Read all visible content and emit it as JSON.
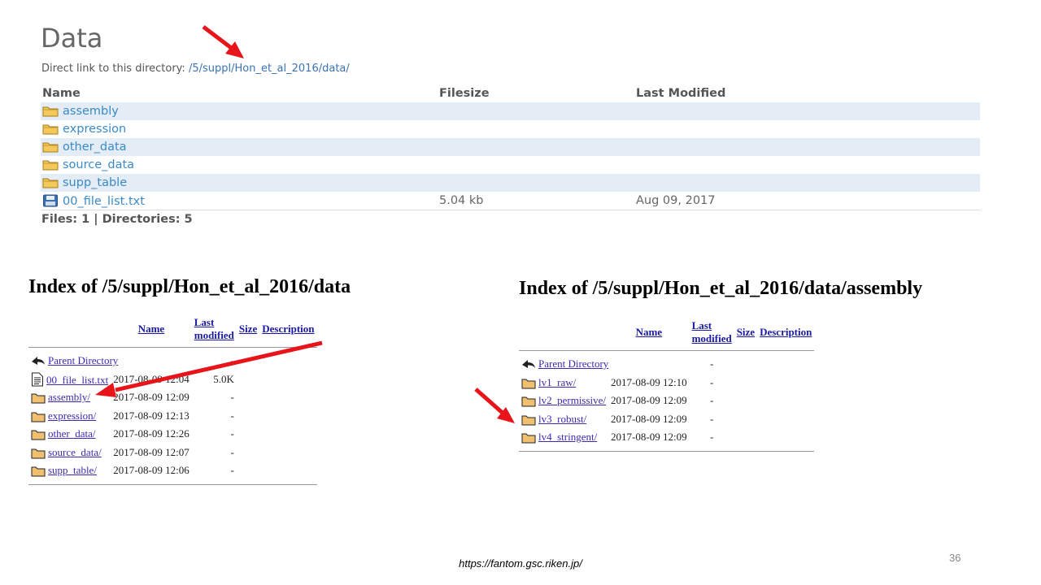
{
  "top": {
    "title": "Data",
    "direct_link_label": "Direct link to this directory:",
    "direct_link": "/5/suppl/Hon_et_al_2016/data/",
    "headers": {
      "name": "Name",
      "filesize": "Filesize",
      "modified": "Last Modified"
    },
    "rows": [
      {
        "name": "assembly",
        "size": "",
        "modified": "",
        "icon": "folder-icon"
      },
      {
        "name": "expression",
        "size": "",
        "modified": "",
        "icon": "folder-icon"
      },
      {
        "name": "other_data",
        "size": "",
        "modified": "",
        "icon": "folder-icon"
      },
      {
        "name": "source_data",
        "size": "",
        "modified": "",
        "icon": "folder-icon"
      },
      {
        "name": "supp_table",
        "size": "",
        "modified": "",
        "icon": "folder-icon"
      },
      {
        "name": "00_file_list.txt",
        "size": "5.04 kb",
        "modified": "Aug 09, 2017",
        "icon": "save-disk-icon"
      }
    ],
    "summary": "Files: 1 | Directories: 5"
  },
  "index_left": {
    "title": "Index of /5/suppl/Hon_et_al_2016/data",
    "headers": {
      "name": "Name",
      "modified": "Last modified",
      "size": "Size",
      "description": "Description"
    },
    "rows": [
      {
        "name": "Parent Directory",
        "modified": "",
        "size": "-",
        "icon": "back-arrow-icon"
      },
      {
        "name": "00_file_list.txt",
        "modified": "2017-08-09 12:04",
        "size": "5.0K",
        "icon": "text-file-icon"
      },
      {
        "name": "assembly/",
        "modified": "2017-08-09 12:09",
        "size": "-",
        "icon": "folder-icon"
      },
      {
        "name": "expression/",
        "modified": "2017-08-09 12:13",
        "size": "-",
        "icon": "folder-icon"
      },
      {
        "name": "other_data/",
        "modified": "2017-08-09 12:26",
        "size": "-",
        "icon": "folder-icon"
      },
      {
        "name": "source_data/",
        "modified": "2017-08-09 12:07",
        "size": "-",
        "icon": "folder-icon"
      },
      {
        "name": "supp_table/",
        "modified": "2017-08-09 12:06",
        "size": "-",
        "icon": "folder-icon"
      }
    ]
  },
  "index_right": {
    "title": "Index of /5/suppl/Hon_et_al_2016/data/assembly",
    "headers": {
      "name": "Name",
      "modified": "Last modified",
      "size": "Size",
      "description": "Description"
    },
    "rows": [
      {
        "name": "Parent Directory",
        "modified": "",
        "size": "-",
        "icon": "back-arrow-icon"
      },
      {
        "name": "lv1_raw/",
        "modified": "2017-08-09 12:10",
        "size": "-",
        "icon": "folder-icon"
      },
      {
        "name": "lv2_permissive/",
        "modified": "2017-08-09 12:09",
        "size": "-",
        "icon": "folder-icon"
      },
      {
        "name": "lv3_robust/",
        "modified": "2017-08-09 12:09",
        "size": "-",
        "icon": "folder-icon"
      },
      {
        "name": "lv4_stringent/",
        "modified": "2017-08-09 12:09",
        "size": "-",
        "icon": "folder-icon"
      }
    ]
  },
  "footer": {
    "url": "https://fantom.gsc.riken.jp/",
    "page_number": "36"
  },
  "colors": {
    "arrow": "#e8141a",
    "link": "#3a8ac8",
    "row_shade": "#e4ecf6",
    "folder": "#e8b548"
  }
}
